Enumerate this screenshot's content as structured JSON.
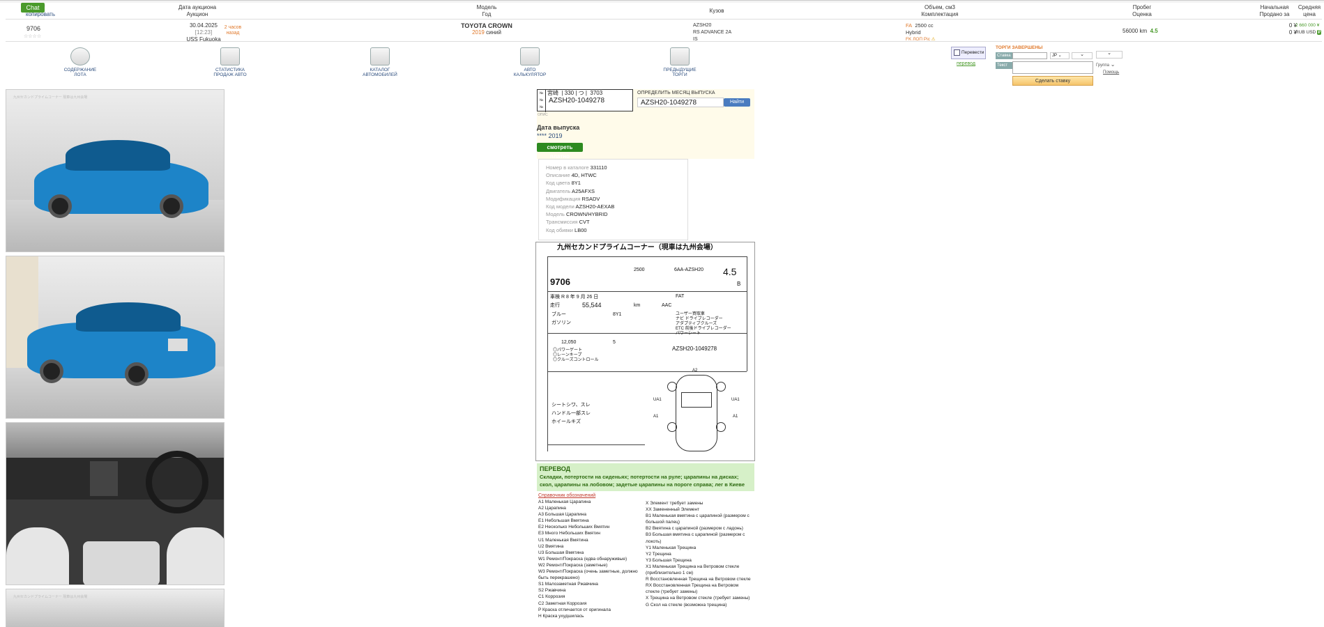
{
  "chat_label": "Chat",
  "header": {
    "lot_label": "Лот",
    "copy_label": "копировать",
    "date_label": "Дата аукциона",
    "auction_label": "Аукцион",
    "model_label": "Модель",
    "year_label": "Год",
    "body_label": "Кузов",
    "volume_label": "Объем, см3",
    "equipment_label": "Комплектация",
    "mileage_label": "Пробег",
    "rating_label": "Оценка",
    "start_label": "Начальная",
    "sold_label": "Продано за",
    "avg_label": "Средняя",
    "price_label": "цена"
  },
  "lot": {
    "number": "9706",
    "stars": "☆☆☆☆",
    "date": "30.04.2025",
    "time": "[12:23]",
    "auction": "USS Fukuoka",
    "ago": "2 часов назад",
    "model": "TOYOTA CROWN",
    "year": "2019",
    "color": "синий",
    "body_code": "AZSH20",
    "grade": "RS ADVANCE 2A",
    "grade2": "IS",
    "fuel": "FA",
    "volume": "2500 cc",
    "hybrid": "Hybrid",
    "fuel_note": "FK ЛОП Pic",
    "mileage": "56000 km",
    "rating": "4.5",
    "start_price": "0 ¥",
    "sold_price": "0 ¥",
    "sold_rub": "RUB USD",
    "avg_price": "2 660 000 ¥"
  },
  "toolbar": [
    {
      "label1": "СОДЕРЖАНИЕ",
      "label2": "ЛОТА"
    },
    {
      "label1": "СТАТИСТИКА",
      "label2": "ПРОДАЖ АВТО"
    },
    {
      "label1": "КАТАЛОГ",
      "label2": "АВТОМОБИЛЕЙ"
    },
    {
      "label1": "АВТО",
      "label2": "КАЛЬКУЛЯТОР"
    },
    {
      "label1": "ПРЕДЫДУЩИЕ",
      "label2": "ТОРГИ"
    }
  ],
  "translate": {
    "button": "Перевести",
    "link": "перевод"
  },
  "bid": {
    "status": "ТОРГИ ЗАВЕРШЕНЫ",
    "bid_label": "Ставка",
    "text_label": "Текст",
    "currency": "JP",
    "group_label": "Группа",
    "help": "Помощь",
    "submit": "Сделать ставку"
  },
  "plate": {
    "region": "宮崎",
    "num1": "330",
    "num2": "つ",
    "num3": "3703",
    "chassis": "AZSH20-1049278",
    "small": "ОПИС"
  },
  "month": {
    "title": "ОПРЕДЕЛИТЬ МЕСЯЦ ВЫПУСКА",
    "value": "AZSH20-1049278",
    "find": "Найти"
  },
  "release": {
    "label": "Дата выпуска",
    "value": "**** 2019",
    "paid_button": "смотреть платно"
  },
  "specs": [
    {
      "k": "Номер в каталоге",
      "v": "331110"
    },
    {
      "k": "Описание",
      "v": "4D, HTWC"
    },
    {
      "k": "Код цвета",
      "v": "8Y1"
    },
    {
      "k": "Двигатель",
      "v": "A25AFXS"
    },
    {
      "k": "Модификация",
      "v": "RSADV"
    },
    {
      "k": "Код модели",
      "v": "AZSH20-AEXAB"
    },
    {
      "k": "Модель",
      "v": "CROWN/HYBRID"
    },
    {
      "k": "Трансмиссия",
      "v": "CVT"
    },
    {
      "k": "Код обивки",
      "v": "LB00"
    }
  ],
  "sheet": {
    "title": "九州セカンドプライムコーナー（現車は九州会場）",
    "lot": "9706",
    "cc": "2500",
    "model_code": "6AA-AZSH20",
    "score": "4.5",
    "interior": "B",
    "shift": "FAT",
    "mileage": "55,544",
    "ac": "AAC",
    "color": "ブルー",
    "color_code": "8Y1",
    "fuel": "ガソリン",
    "recycle": "12,050",
    "seats": "5",
    "chassis": "AZSH20-1049278",
    "notes": "シートシワ、スレ",
    "notes2": "ハンドル一部スレ",
    "notes3": "ホイールキズ"
  },
  "translation": {
    "title": "ПЕРЕВОД",
    "text": "Складки, потертости на сиденьях; потертости на руле; царапины на дисках; скол, царапины на лобовом; задетые царапины на пороге справа; лег в Киеве"
  },
  "legend_title": "Справочник обозначений",
  "legend_left": [
    "A1 Маленькая Царапина",
    "A2 Царапина",
    "A3 Большая Царапина",
    "E1 Небольшая Вмятина",
    "E2 Несколько Небольших Вмятин",
    "E3 Много Небольших Вмятин",
    "U1 Маленькая Вмятина",
    "U2 Вмятина",
    "U3 Большая Вмятина",
    "W1 Ремонт/Покраска (едва обнаруживые)",
    "W2 Ремонт/Покраска (заметные)",
    "W3 Ремонт/Покраска (очень заметные, должно",
    "быть перекрашено)",
    "S1 Малозаметная Ржавчина",
    "S2 Ржавчина",
    "C1 Коррозия",
    "C2 Заметная Коррозия",
    "P Краска отличается от оригинала",
    "H Краска ухудшилась"
  ],
  "legend_right": [
    "X Элемент требует замены",
    "XX Замененный Элемент",
    "B1 Маленькая вмятина с царапиной (размером с",
    "большой палец)",
    "B2 Вмятина с царапиной (размером с ладонь)",
    "B3 Большая вмятина с царапиной (размером с",
    "локоть)",
    "Y1 Маленькая Трещина",
    "Y2 Трещина",
    "Y3 Большая Трещина",
    "X1 Маленькая Трещина на Ветровом стекле",
    "(приблизительно 1 см)",
    "R Восстановленная Трещина на Ветровом стекле",
    "RX Восстановленная Трещина на Ветровом",
    "стекле (требует замены)",
    "X Трещина на Ветровом стекле (требует замены)",
    "G Скол на стекле (возможна трещина)"
  ],
  "colors": {
    "accent": "#4a9a2b",
    "link": "#2a4b7c",
    "orange": "#e0782a",
    "car": "#1d84c8"
  }
}
